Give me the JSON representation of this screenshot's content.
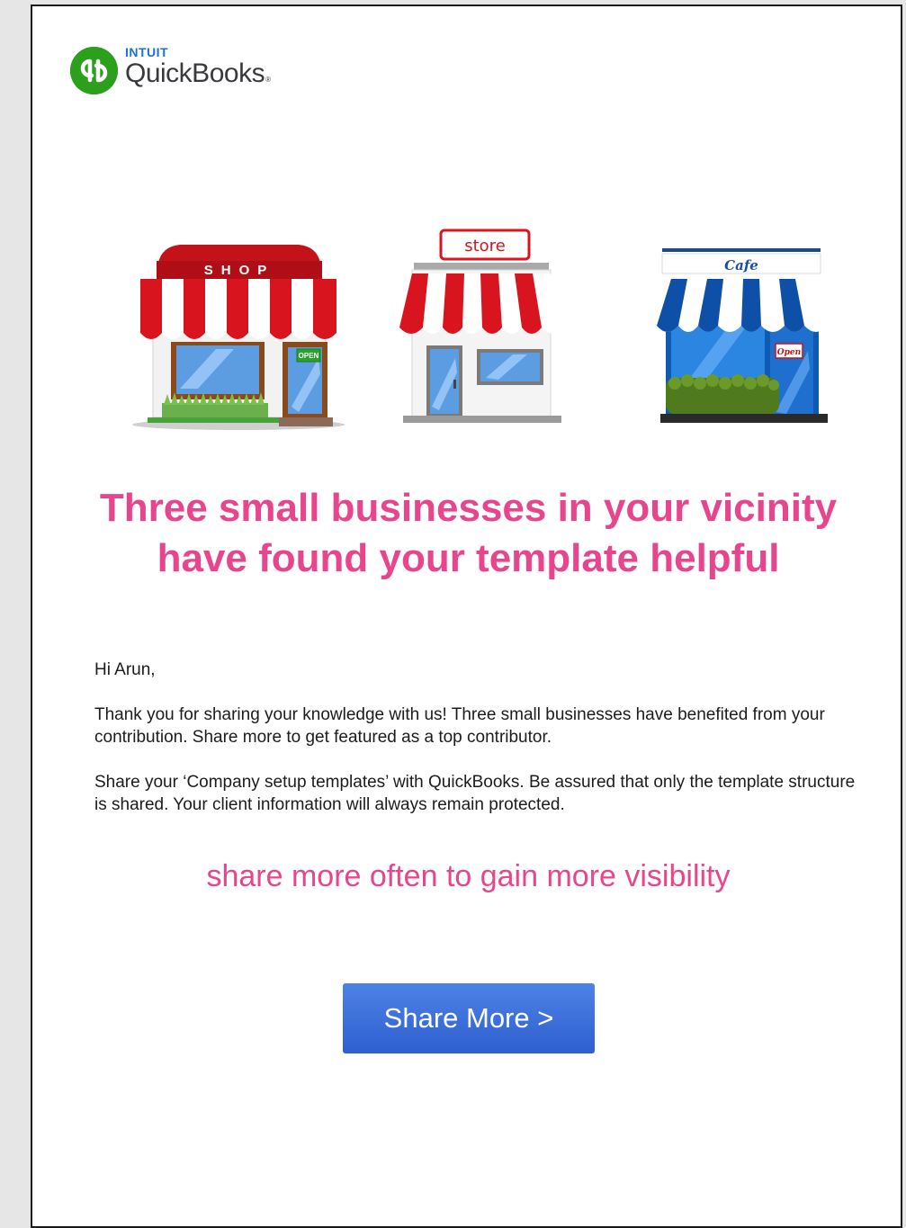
{
  "logo": {
    "intuit": "INTUIT",
    "brand": "QuickBooks",
    "trademark": "®"
  },
  "stores": [
    {
      "sign": "SHOP",
      "door_sign": "OPEN"
    },
    {
      "sign": "store"
    },
    {
      "sign": "Cafe",
      "door_sign": "Open"
    }
  ],
  "headline": {
    "line1": "Three small businesses in your vicinity",
    "line2": "have found your template helpful"
  },
  "body": {
    "greeting": "Hi Arun,",
    "paragraph1": "Thank you for sharing your knowledge with us! Three small businesses have benefited from your contribution. Share more to get featured as a top contributor.",
    "paragraph2": "Share your ‘Company setup templates’ with QuickBooks. Be assured that only the template structure is shared. Your client information will always remain protected."
  },
  "tagline": "share more often to gain more visibility",
  "cta": {
    "label": "Share More >"
  },
  "colors": {
    "accent_pink": "#e8468c",
    "button_blue": "#3a6fdc",
    "brand_green": "#2ca01c",
    "intuit_blue": "#1e6fd9"
  }
}
